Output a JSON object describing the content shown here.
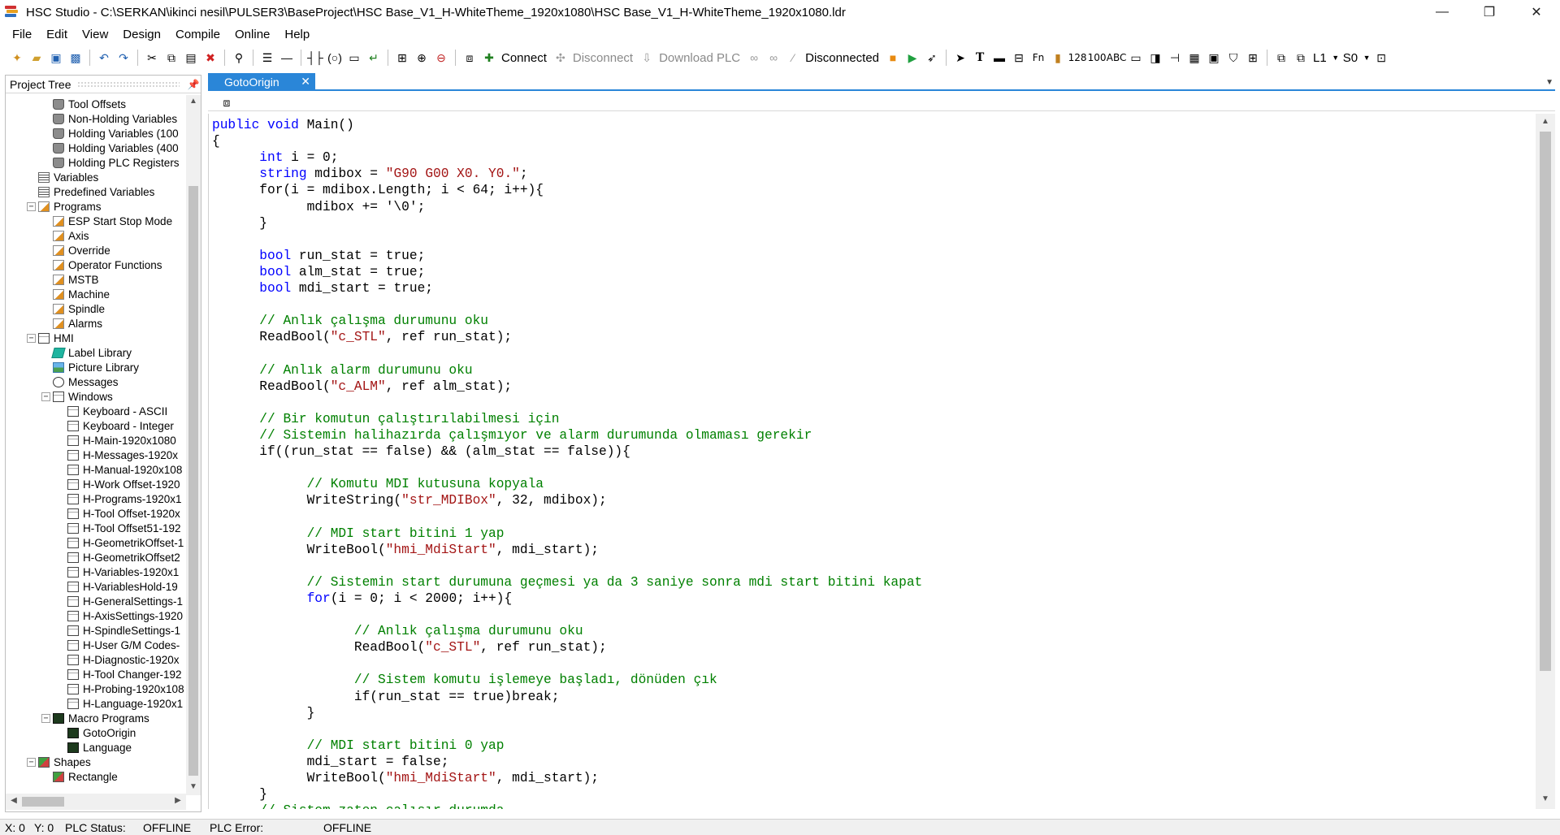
{
  "window": {
    "title": "HSC Studio - C:\\SERKAN\\ikinci nesil\\PULSER3\\BaseProject\\HSC Base_V1_H-WhiteTheme_1920x1080\\HSC Base_V1_H-WhiteTheme_1920x1080.ldr",
    "minimize": "—",
    "restore": "❐",
    "close": "✕"
  },
  "menu": [
    "File",
    "Edit",
    "View",
    "Design",
    "Compile",
    "Online",
    "Help"
  ],
  "toolbar": {
    "connect": "Connect",
    "disconnect": "Disconnect",
    "download": "Download PLC",
    "status": "Disconnected",
    "level": "L1",
    "station": "S0",
    "abc": "ABC",
    "num128": "128",
    "num100": "100",
    "fn": "Fn"
  },
  "tree": {
    "title": "Project Tree",
    "items": [
      {
        "label": "Tool Offsets",
        "level": 3,
        "icon": "db"
      },
      {
        "label": "Non-Holding Variables",
        "level": 3,
        "icon": "db"
      },
      {
        "label": "Holding Variables (100",
        "level": 3,
        "icon": "db"
      },
      {
        "label": "Holding Variables (400",
        "level": 3,
        "icon": "db"
      },
      {
        "label": "Holding PLC Registers",
        "level": 3,
        "icon": "db"
      },
      {
        "label": "Variables",
        "level": 2,
        "icon": "grid"
      },
      {
        "label": "Predefined Variables",
        "level": 2,
        "icon": "grid"
      },
      {
        "label": "Programs",
        "level": 2,
        "icon": "prog",
        "expander": "−"
      },
      {
        "label": "ESP Start Stop Mode",
        "level": 3,
        "icon": "prog"
      },
      {
        "label": "Axis",
        "level": 3,
        "icon": "prog"
      },
      {
        "label": "Override",
        "level": 3,
        "icon": "prog"
      },
      {
        "label": "Operator Functions",
        "level": 3,
        "icon": "prog"
      },
      {
        "label": "MSTB",
        "level": 3,
        "icon": "prog"
      },
      {
        "label": "Machine",
        "level": 3,
        "icon": "prog"
      },
      {
        "label": "Spindle",
        "level": 3,
        "icon": "prog"
      },
      {
        "label": "Alarms",
        "level": 3,
        "icon": "prog"
      },
      {
        "label": "HMI",
        "level": 2,
        "icon": "win",
        "expander": "−"
      },
      {
        "label": "Label Library",
        "level": 3,
        "icon": "tag"
      },
      {
        "label": "Picture Library",
        "level": 3,
        "icon": "pic"
      },
      {
        "label": "Messages",
        "level": 3,
        "icon": "msg"
      },
      {
        "label": "Windows",
        "level": 3,
        "icon": "win",
        "expander": "−"
      },
      {
        "label": "Keyboard - ASCII",
        "level": 4,
        "icon": "win"
      },
      {
        "label": "Keyboard - Integer",
        "level": 4,
        "icon": "win"
      },
      {
        "label": "H-Main-1920x1080",
        "level": 4,
        "icon": "win"
      },
      {
        "label": "H-Messages-1920x",
        "level": 4,
        "icon": "win"
      },
      {
        "label": "H-Manual-1920x108",
        "level": 4,
        "icon": "win"
      },
      {
        "label": "H-Work Offset-1920",
        "level": 4,
        "icon": "win"
      },
      {
        "label": "H-Programs-1920x1",
        "level": 4,
        "icon": "win"
      },
      {
        "label": "H-Tool Offset-1920x",
        "level": 4,
        "icon": "win"
      },
      {
        "label": "H-Tool Offset51-192",
        "level": 4,
        "icon": "win"
      },
      {
        "label": "H-GeometrikOffset-1",
        "level": 4,
        "icon": "win"
      },
      {
        "label": "H-GeometrikOffset2",
        "level": 4,
        "icon": "win"
      },
      {
        "label": "H-Variables-1920x1",
        "level": 4,
        "icon": "win"
      },
      {
        "label": "H-VariablesHold-19",
        "level": 4,
        "icon": "win"
      },
      {
        "label": "H-GeneralSettings-1",
        "level": 4,
        "icon": "win"
      },
      {
        "label": "H-AxisSettings-1920",
        "level": 4,
        "icon": "win"
      },
      {
        "label": "H-SpindleSettings-1",
        "level": 4,
        "icon": "win"
      },
      {
        "label": "H-User G/M Codes-",
        "level": 4,
        "icon": "win"
      },
      {
        "label": "H-Diagnostic-1920x",
        "level": 4,
        "icon": "win"
      },
      {
        "label": "H-Tool Changer-192",
        "level": 4,
        "icon": "win"
      },
      {
        "label": "H-Probing-1920x108",
        "level": 4,
        "icon": "win"
      },
      {
        "label": "H-Language-1920x1",
        "level": 4,
        "icon": "win"
      },
      {
        "label": "Macro Programs",
        "level": 3,
        "icon": "macro",
        "expander": "−"
      },
      {
        "label": "GotoOrigin",
        "level": 4,
        "icon": "macro"
      },
      {
        "label": "Language",
        "level": 4,
        "icon": "macro"
      },
      {
        "label": "Shapes",
        "level": 2,
        "icon": "shape",
        "expander": "−"
      },
      {
        "label": "Rectangle",
        "level": 3,
        "icon": "shape"
      }
    ]
  },
  "editor": {
    "tab": "GotoOrigin",
    "lines": [
      [
        [
          "kw",
          "public void "
        ],
        [
          "",
          "Main()"
        ]
      ],
      [
        [
          "",
          "{"
        ]
      ],
      [
        [
          "",
          "      "
        ],
        [
          "kw",
          "int"
        ],
        [
          "",
          " i = 0;"
        ]
      ],
      [
        [
          "",
          "      "
        ],
        [
          "kw",
          "string"
        ],
        [
          "",
          " mdibox = "
        ],
        [
          "str",
          "\"G90 G00 X0. Y0.\""
        ],
        [
          "",
          ";"
        ]
      ],
      [
        [
          "",
          "      for(i = mdibox.Length; i < 64; i++){"
        ]
      ],
      [
        [
          "",
          "            mdibox += '\\0';"
        ]
      ],
      [
        [
          "",
          "      }"
        ]
      ],
      [
        [
          "",
          ""
        ]
      ],
      [
        [
          "",
          "      "
        ],
        [
          "kw",
          "bool"
        ],
        [
          "",
          " run_stat = true;"
        ]
      ],
      [
        [
          "",
          "      "
        ],
        [
          "kw",
          "bool"
        ],
        [
          "",
          " alm_stat = true;"
        ]
      ],
      [
        [
          "",
          "      "
        ],
        [
          "kw",
          "bool"
        ],
        [
          "",
          " mdi_start = true;"
        ]
      ],
      [
        [
          "",
          ""
        ]
      ],
      [
        [
          "",
          "      "
        ],
        [
          "cmt",
          "// Anlık çalışma durumunu oku"
        ]
      ],
      [
        [
          "",
          "      ReadBool("
        ],
        [
          "str",
          "\"c_STL\""
        ],
        [
          "",
          ", ref run_stat);"
        ]
      ],
      [
        [
          "",
          ""
        ]
      ],
      [
        [
          "",
          "      "
        ],
        [
          "cmt",
          "// Anlık alarm durumunu oku"
        ]
      ],
      [
        [
          "",
          "      ReadBool("
        ],
        [
          "str",
          "\"c_ALM\""
        ],
        [
          "",
          ", ref alm_stat);"
        ]
      ],
      [
        [
          "",
          ""
        ]
      ],
      [
        [
          "",
          "      "
        ],
        [
          "cmt",
          "// Bir komutun çalıştırılabilmesi için"
        ]
      ],
      [
        [
          "",
          "      "
        ],
        [
          "cmt",
          "// Sistemin halihazırda çalışmıyor ve alarm durumunda olmaması gerekir"
        ]
      ],
      [
        [
          "",
          "      if((run_stat == false) && (alm_stat == false)){"
        ]
      ],
      [
        [
          "",
          ""
        ]
      ],
      [
        [
          "",
          "            "
        ],
        [
          "cmt",
          "// Komutu MDI kutusuna kopyala"
        ]
      ],
      [
        [
          "",
          "            WriteString("
        ],
        [
          "str",
          "\"str_MDIBox\""
        ],
        [
          "",
          ", 32, mdibox);"
        ]
      ],
      [
        [
          "",
          ""
        ]
      ],
      [
        [
          "",
          "            "
        ],
        [
          "cmt",
          "// MDI start bitini 1 yap"
        ]
      ],
      [
        [
          "",
          "            WriteBool("
        ],
        [
          "str",
          "\"hmi_MdiStart\""
        ],
        [
          "",
          ", mdi_start);"
        ]
      ],
      [
        [
          "",
          ""
        ]
      ],
      [
        [
          "",
          "            "
        ],
        [
          "cmt",
          "// Sistemin start durumuna geçmesi ya da 3 saniye sonra mdi start bitini kapat"
        ]
      ],
      [
        [
          "",
          "            "
        ],
        [
          "kw",
          "for"
        ],
        [
          "",
          "(i = 0; i < 2000; i++){"
        ]
      ],
      [
        [
          "",
          ""
        ]
      ],
      [
        [
          "",
          "                  "
        ],
        [
          "cmt",
          "// Anlık çalışma durumunu oku"
        ]
      ],
      [
        [
          "",
          "                  ReadBool("
        ],
        [
          "str",
          "\"c_STL\""
        ],
        [
          "",
          ", ref run_stat);"
        ]
      ],
      [
        [
          "",
          ""
        ]
      ],
      [
        [
          "",
          "                  "
        ],
        [
          "cmt",
          "// Sistem komutu işlemeye başladı, dönüden çık"
        ]
      ],
      [
        [
          "",
          "                  if(run_stat == true)break;"
        ]
      ],
      [
        [
          "",
          "            }"
        ]
      ],
      [
        [
          "",
          ""
        ]
      ],
      [
        [
          "",
          "            "
        ],
        [
          "cmt",
          "// MDI start bitini 0 yap"
        ]
      ],
      [
        [
          "",
          "            mdi_start = false;"
        ]
      ],
      [
        [
          "",
          "            WriteBool("
        ],
        [
          "str",
          "\"hmi_MdiStart\""
        ],
        [
          "",
          ", mdi_start);"
        ]
      ],
      [
        [
          "",
          "      }"
        ]
      ],
      [
        [
          "",
          "      "
        ],
        [
          "cmt",
          "// Sistem zaten çalışır durumda"
        ]
      ]
    ]
  },
  "status": {
    "x": "X:  0",
    "y": "Y:  0",
    "plc_status_label": "PLC Status:",
    "plc_status": "OFFLINE",
    "plc_error_label": "PLC Error:",
    "plc_error": "OFFLINE"
  },
  "colors": {
    "accent": "#2a86d8",
    "keyword": "#0000ff",
    "string": "#a31515",
    "comment": "#008000"
  }
}
